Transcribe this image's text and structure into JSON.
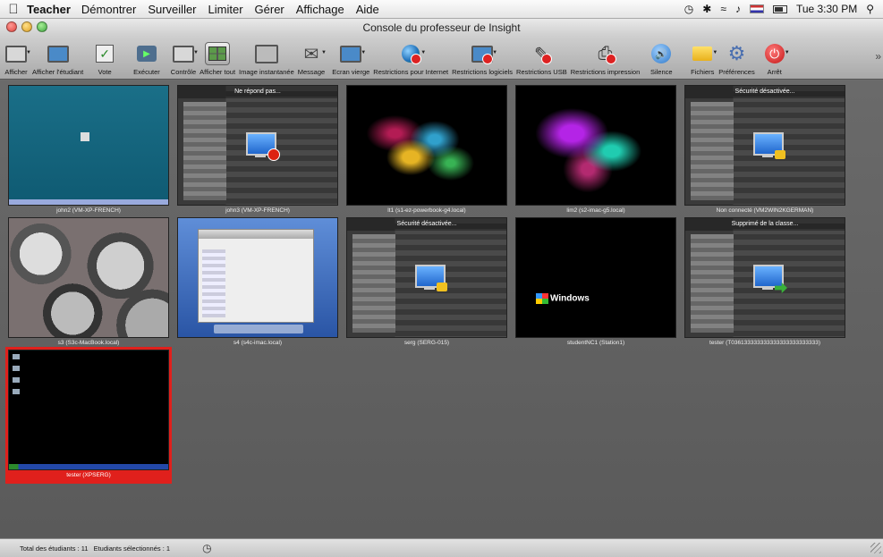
{
  "menubar": {
    "app_name": "Teacher",
    "menus": [
      "Démontrer",
      "Surveiller",
      "Limiter",
      "Gérer",
      "Affichage",
      "Aide"
    ],
    "clock": "Tue 3:30 PM"
  },
  "window": {
    "title": "Console du professeur de Insight"
  },
  "toolbar": {
    "items": [
      {
        "label": "Afficher",
        "icon": "display-icon"
      },
      {
        "label": "Afficher l'étudiant",
        "icon": "student-screen-icon"
      },
      {
        "label": "Vote",
        "icon": "vote-icon"
      },
      {
        "label": "Exécuter",
        "icon": "run-icon"
      },
      {
        "label": "Contrôle",
        "icon": "control-icon"
      },
      {
        "label": "Afficher tout",
        "icon": "grid-icon"
      },
      {
        "label": "Image instantanée",
        "icon": "snapshot-icon"
      },
      {
        "label": "Message",
        "icon": "message-icon"
      },
      {
        "label": "Ecran vierge",
        "icon": "blank-screen-icon"
      },
      {
        "label": "Restrictions pour Internet",
        "icon": "internet-icon"
      },
      {
        "label": "Restrictions logiciels",
        "icon": "software-icon"
      },
      {
        "label": "Restrictions USB",
        "icon": "usb-icon"
      },
      {
        "label": "Restrictions impression",
        "icon": "printer-icon"
      },
      {
        "label": "Silence",
        "icon": "speaker-icon"
      },
      {
        "label": "Fichiers",
        "icon": "folder-icon"
      },
      {
        "label": "Préférences",
        "icon": "gear-icon"
      },
      {
        "label": "Arrêt",
        "icon": "power-icon"
      }
    ],
    "more": "»"
  },
  "students": [
    {
      "caption": "john2 (VM-XP-FRENCH)",
      "status": ""
    },
    {
      "caption": "john3 (VM-XP-FRENCH)",
      "status": "Ne répond pas..."
    },
    {
      "caption": "lt1 (s1-ez-powerbook-g4.local)",
      "status": ""
    },
    {
      "caption": "lim2 (s2-imac-g5.local)",
      "status": ""
    },
    {
      "caption": "Non connecté (VM2WIN2KGERMAN)",
      "status": "Sécurité désactivée..."
    },
    {
      "caption": "s3 (S3c-MacBook.local)",
      "status": ""
    },
    {
      "caption": "s4 (s4c-imac.local)",
      "status": ""
    },
    {
      "caption": "serg (SERG-015)",
      "status": "Sécurité désactivée..."
    },
    {
      "caption": "studentNC1 (Station1)",
      "status": "",
      "logo": "Windows"
    },
    {
      "caption": "tester (T036133333333333333333333333)",
      "status": "Supprimé de la classe..."
    },
    {
      "caption": "tester (XPSERG)",
      "status": "",
      "selected": true
    }
  ],
  "statusbar": {
    "total": "Total des étudiants : 11",
    "selected": "Etudiants sélectionnés : 1"
  }
}
